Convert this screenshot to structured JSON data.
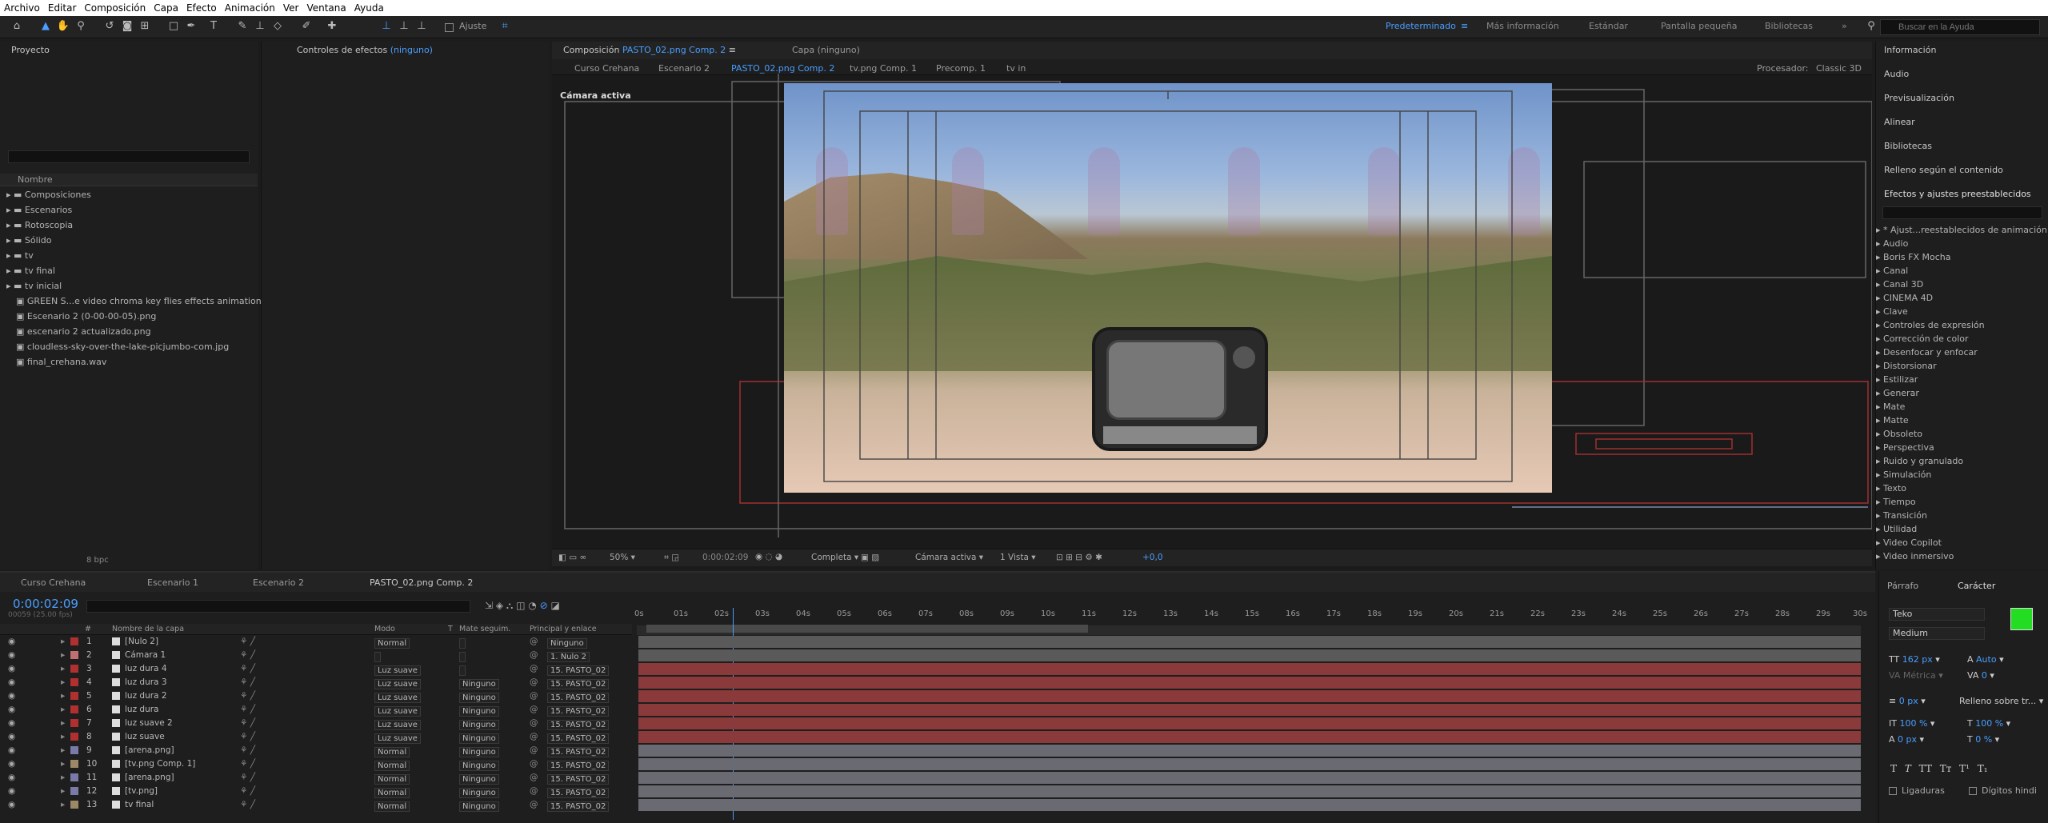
{
  "menubar": [
    "Archivo",
    "Editar",
    "Composición",
    "Capa",
    "Efecto",
    "Animación",
    "Ver",
    "Ventana",
    "Ayuda"
  ],
  "toolbar": {
    "snap_label": "Ajuste",
    "workspaces": [
      "Predeterminado",
      "Más información",
      "Estándar",
      "Pantalla pequeña",
      "Bibliotecas"
    ],
    "help_placeholder": "Buscar en la Ayuda"
  },
  "project": {
    "title": "Proyecto",
    "column": "Nombre",
    "items": [
      "Composiciones",
      "Escenarios",
      "Rotoscopia",
      "Sólido",
      "tv",
      "tv final",
      "tv inicial",
      "GREEN S...e video   chroma key flies effects animation",
      "Escenario 2 (0-00-00-05).png",
      "escenario 2 actualizado.png",
      "cloudless-sky-over-the-lake-picjumbo-com.jpg",
      "final_crehana.wav"
    ],
    "bpc": "8 bpc"
  },
  "effects_controls": {
    "title": "Controles de efectos",
    "target": "(ninguno)"
  },
  "composition": {
    "tab_label": "Composición",
    "tab_name": "PASTO_02.png Comp. 2",
    "layer_tab": "Capa  (ninguno)",
    "breadcrumbs": [
      "Curso Crehana",
      "Escenario 2",
      "PASTO_02.png Comp. 2",
      "tv.png Comp. 1",
      "Precomp. 1",
      "tv in"
    ],
    "renderer_label": "Procesador:",
    "renderer": "Classic 3D",
    "camera_label": "Cámara activa",
    "zoom": "50%",
    "timecode": "0:00:02:09",
    "resolution": "Completa",
    "view_camera": "Cámara activa",
    "views": "1 Vista",
    "exposure": "+0,0"
  },
  "right_panel": {
    "sections": [
      "Información",
      "Audio",
      "Previsualización",
      "Alinear",
      "Bibliotecas",
      "Relleno según el contenido"
    ],
    "effects_title": "Efectos y ajustes preestablecidos",
    "effects": [
      "* Ajust...reestablecidos de animación",
      "Audio",
      "Boris FX Mocha",
      "Canal",
      "Canal 3D",
      "CINEMA 4D",
      "Clave",
      "Controles de expresión",
      "Corrección de color",
      "Desenfocar y enfocar",
      "Distorsionar",
      "Estilizar",
      "Generar",
      "Mate",
      "Matte",
      "Obsoleto",
      "Perspectiva",
      "Ruido y granulado",
      "Simulación",
      "Texto",
      "Tiempo",
      "Transición",
      "Utilidad",
      "Video Copilot",
      "Video inmersivo"
    ]
  },
  "character": {
    "tabs": [
      "Párrafo",
      "Carácter"
    ],
    "font": "Teko",
    "style": "Medium",
    "size": "162 px",
    "leading": "Auto",
    "kerning": "Métrica",
    "tracking": "0",
    "stroke": "0 px",
    "stroke_mode": "Relleno sobre tr...",
    "vscale": "100 %",
    "hscale": "100 %",
    "baseline": "0 px",
    "tsume": "0 %",
    "ligatures": "Ligaduras",
    "hindi": "Dígitos hindi",
    "fill_color": "#22dd22"
  },
  "timeline": {
    "tabs": [
      "Curso Crehana",
      "Escenario 1",
      "Escenario 2",
      "PASTO_02.png Comp. 2"
    ],
    "timecode": "0:00:02:09",
    "frames": "00059 (25.00 fps)",
    "headers": [
      "#",
      "Nombre de la capa",
      "Modo",
      "T",
      "Mate seguim.",
      "Principal y enlace"
    ],
    "ruler": [
      "0s",
      "01s",
      "02s",
      "03s",
      "04s",
      "05s",
      "06s",
      "07s",
      "08s",
      "09s",
      "10s",
      "11s",
      "12s",
      "13s",
      "14s",
      "15s",
      "16s",
      "17s",
      "18s",
      "19s",
      "20s",
      "21s",
      "22s",
      "23s",
      "24s",
      "25s",
      "26s",
      "27s",
      "28s",
      "29s",
      "30s"
    ],
    "layers": [
      {
        "n": "1",
        "name": "[Nulo 2]",
        "mode": "Normal",
        "matte": "",
        "parent": "Ninguno",
        "color": "#b03030"
      },
      {
        "n": "2",
        "name": "Cámara 1",
        "mode": "",
        "matte": "",
        "parent": "1. Nulo 2",
        "color": "#c07070"
      },
      {
        "n": "3",
        "name": "luz dura 4",
        "mode": "Luz suave",
        "matte": "",
        "parent": "15. PASTO_02",
        "color": "#b03030"
      },
      {
        "n": "4",
        "name": "luz dura 3",
        "mode": "Luz suave",
        "matte": "Ninguno",
        "parent": "15. PASTO_02",
        "color": "#b03030"
      },
      {
        "n": "5",
        "name": "luz dura 2",
        "mode": "Luz suave",
        "matte": "Ninguno",
        "parent": "15. PASTO_02",
        "color": "#b03030"
      },
      {
        "n": "6",
        "name": "luz dura",
        "mode": "Luz suave",
        "matte": "Ninguno",
        "parent": "15. PASTO_02",
        "color": "#b03030"
      },
      {
        "n": "7",
        "name": "luz suave 2",
        "mode": "Luz suave",
        "matte": "Ninguno",
        "parent": "15. PASTO_02",
        "color": "#b03030"
      },
      {
        "n": "8",
        "name": "luz suave",
        "mode": "Luz suave",
        "matte": "Ninguno",
        "parent": "15. PASTO_02",
        "color": "#b03030"
      },
      {
        "n": "9",
        "name": "[arena.png]",
        "mode": "Normal",
        "matte": "Ninguno",
        "parent": "15. PASTO_02",
        "color": "#7a7aa8"
      },
      {
        "n": "10",
        "name": "[tv.png Comp. 1]",
        "mode": "Normal",
        "matte": "Ninguno",
        "parent": "15. PASTO_02",
        "color": "#9a8866"
      },
      {
        "n": "11",
        "name": "[arena.png]",
        "mode": "Normal",
        "matte": "Ninguno",
        "parent": "15. PASTO_02",
        "color": "#7a7aa8"
      },
      {
        "n": "12",
        "name": "[tv.png]",
        "mode": "Normal",
        "matte": "Ninguno",
        "parent": "15. PASTO_02",
        "color": "#7a7aa8"
      },
      {
        "n": "13",
        "name": "tv final",
        "mode": "Normal",
        "matte": "Ninguno",
        "parent": "15. PASTO_02",
        "color": "#9a8866"
      }
    ]
  }
}
